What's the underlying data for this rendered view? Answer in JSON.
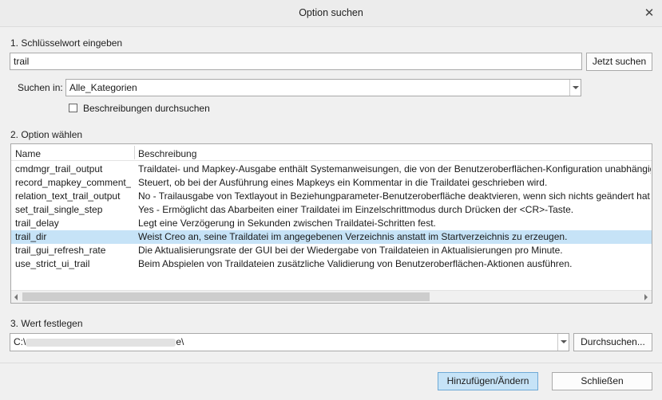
{
  "window": {
    "title": "Option suchen"
  },
  "step1": {
    "label": "1. Schlüsselwort eingeben",
    "keyword": "trail",
    "search_button": "Jetzt suchen",
    "search_in_label": "Suchen in:",
    "category": "Alle_Kategorien",
    "desc_checkbox_label": "Beschreibungen durchsuchen",
    "desc_checkbox_checked": false
  },
  "step2": {
    "label": "2. Option wählen",
    "columns": [
      "Name",
      "Beschreibung"
    ],
    "rows": [
      {
        "name": "cmdmgr_trail_output",
        "desc": "Traildatei- und Mapkey-Ausgabe enthält Systemanweisungen, die von der Benutzeroberflächen-Konfiguration unabhängig"
      },
      {
        "name": "record_mapkey_comment_",
        "desc": "Steuert, ob bei der Ausführung eines Mapkeys ein Kommentar in die Traildatei geschrieben wird."
      },
      {
        "name": "relation_text_trail_output",
        "desc": "No - Trailausgabe von Textlayout in Beziehungparameter-Benutzeroberfläche deaktvieren, wenn sich nichts geändert hat."
      },
      {
        "name": "set_trail_single_step",
        "desc": "Yes - Ermöglicht das Abarbeiten einer Traildatei im Einzelschrittmodus durch Drücken der <CR>-Taste."
      },
      {
        "name": "trail_delay",
        "desc": "Legt eine Verzögerung in Sekunden zwischen Traildatei-Schritten fest."
      },
      {
        "name": "trail_dir",
        "desc": "Weist Creo an, seine Traildatei im angegebenen Verzeichnis anstatt im Startverzeichnis zu erzeugen."
      },
      {
        "name": "trail_gui_refresh_rate",
        "desc": "Die Aktualisierungsrate der GUI bei der Wiedergabe von Traildateien in Aktualisierungen pro Minute."
      },
      {
        "name": "use_strict_ui_trail",
        "desc": "Beim Abspielen von Traildateien zusätzliche Validierung von Benutzeroberflächen-Aktionen ausführen."
      }
    ],
    "selected_index": 5
  },
  "step3": {
    "label": "3. Wert festlegen",
    "value_prefix": "C:\\",
    "value_suffix": "e\\",
    "browse_button": "Durchsuchen..."
  },
  "footer": {
    "apply_button": "Hinzufügen/Ändern",
    "close_button": "Schließen"
  }
}
